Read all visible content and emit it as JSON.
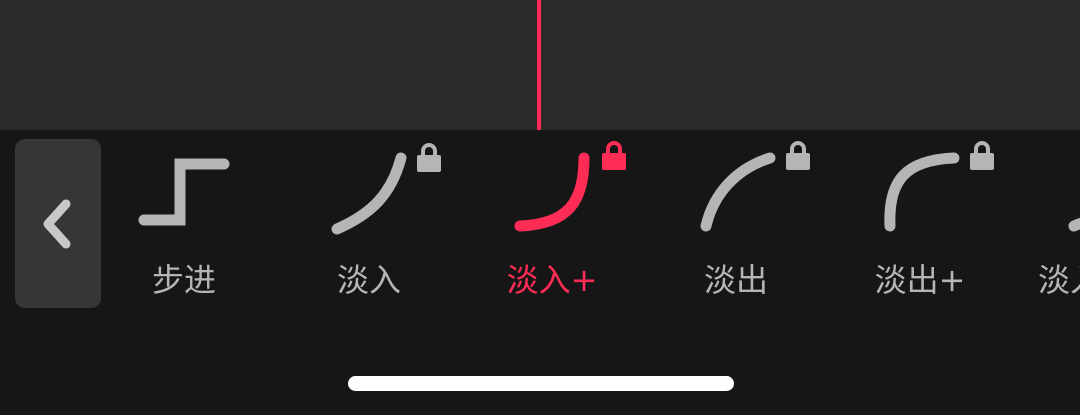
{
  "colors": {
    "timeline_bg": "#2a2a2a",
    "panel_bg": "#161616",
    "playhead": "#ff2d55",
    "inactive": "#b5b5b5",
    "active": "#ff2d55",
    "back_button_bg": "#363636"
  },
  "back_button": {
    "icon": "chevron-left-icon"
  },
  "curve_options": [
    {
      "label": "步进",
      "icon": "step-curve-icon",
      "locked": false,
      "selected": false
    },
    {
      "label": "淡入",
      "icon": "ease-in-curve-icon",
      "locked": true,
      "selected": false
    },
    {
      "label": "淡入+",
      "icon": "ease-in-plus-curve-icon",
      "locked": true,
      "selected": true
    },
    {
      "label": "淡出",
      "icon": "ease-out-curve-icon",
      "locked": true,
      "selected": false
    },
    {
      "label": "淡出+",
      "icon": "ease-out-plus-curve-icon",
      "locked": true,
      "selected": false
    },
    {
      "label": "淡入",
      "icon": "ease-in-out-curve-icon",
      "locked": false,
      "selected": false
    }
  ]
}
